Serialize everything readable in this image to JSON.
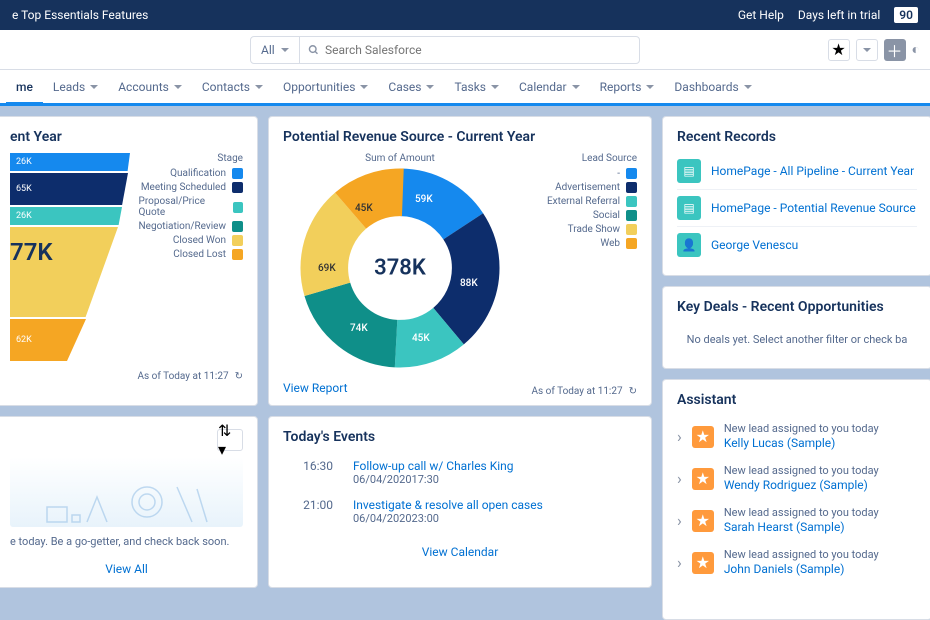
{
  "topbar": {
    "left": "e Top Essentials Features",
    "help": "Get Help",
    "daysleft_label": "Days left in trial",
    "days": "90"
  },
  "search": {
    "all": "All",
    "placeholder": "Search Salesforce"
  },
  "nav": [
    "me",
    "Leads",
    "Accounts",
    "Contacts",
    "Opportunities",
    "Cases",
    "Tasks",
    "Calendar",
    "Reports",
    "Dashboards"
  ],
  "funnel_card": {
    "title": "ent Year",
    "legend_title": "Stage",
    "legend": [
      {
        "label": "Qualification",
        "color": "#1589ee"
      },
      {
        "label": "Meeting Scheduled",
        "color": "#0d2d6c"
      },
      {
        "label": "Proposal/Price Quote",
        "color": "#3bc5c0"
      },
      {
        "label": "Negotiation/Review",
        "color": "#0f8f89"
      },
      {
        "label": "Closed Won",
        "color": "#f2cf5b"
      },
      {
        "label": "Closed Lost",
        "color": "#f5a623"
      }
    ],
    "segments": [
      "26K",
      "65K",
      "26K",
      "62K"
    ],
    "total": "77K",
    "asof": "As of Today at 11:27"
  },
  "donut_card": {
    "title": "Potential Revenue Source - Current Year",
    "subtitle": "Sum of Amount",
    "legend_title": "Lead Source",
    "legend": [
      {
        "label": "-",
        "color": "#1589ee"
      },
      {
        "label": "Advertisement",
        "color": "#0d2d6c"
      },
      {
        "label": "External Referral",
        "color": "#3bc5c0"
      },
      {
        "label": "Social",
        "color": "#0f8f89"
      },
      {
        "label": "Trade Show",
        "color": "#f2cf5b"
      },
      {
        "label": "Web",
        "color": "#f5a623"
      }
    ],
    "total": "378K",
    "labels": [
      "59K",
      "88K",
      "45K",
      "74K",
      "69K",
      "45K"
    ],
    "view_report": "View Report",
    "asof": "As of Today at 11:27"
  },
  "events_card": {
    "title": "Today's Events",
    "items": [
      {
        "time": "16:30",
        "title": "Follow-up call w/ Charles King",
        "dt": "06/04/202017:30"
      },
      {
        "time": "21:00",
        "title": "Investigate & resolve all open cases",
        "dt": "06/04/202023:00"
      }
    ],
    "link": "View Calendar"
  },
  "gogetter": {
    "text": "e today. Be a go-getter, and check back soon.",
    "link": "View All"
  },
  "records": {
    "title": "Recent Records",
    "items": [
      {
        "icon": "#3bc5c0",
        "label": "HomePage - All Pipeline - Current Year"
      },
      {
        "icon": "#3bc5c0",
        "label": "HomePage - Potential Revenue Source"
      },
      {
        "icon": "#3bc5c0",
        "label": "George Venescu",
        "user": true
      }
    ]
  },
  "deals": {
    "title": "Key Deals - Recent Opportunities",
    "empty": "No deals yet. Select another filter or check ba"
  },
  "assistant": {
    "title": "Assistant",
    "msg": "New lead assigned to you today",
    "items": [
      "Kelly Lucas (Sample)",
      "Wendy Rodriguez (Sample)",
      "Sarah Hearst (Sample)",
      "John Daniels (Sample)"
    ]
  },
  "chart_data": [
    {
      "type": "funnel",
      "title": "Pipeline - Current Year",
      "stages": [
        "Qualification",
        "Meeting Scheduled",
        "Proposal/Price Quote",
        "Negotiation/Review",
        "Closed Won",
        "Closed Lost"
      ],
      "visible_values_k": [
        26,
        65,
        26,
        62
      ],
      "highlighted_k": 77
    },
    {
      "type": "pie",
      "title": "Potential Revenue Source - Current Year",
      "categories": [
        "-",
        "Advertisement",
        "External Referral",
        "Social",
        "Trade Show",
        "Web"
      ],
      "values": [
        59,
        88,
        45,
        74,
        69,
        45
      ],
      "total": 378,
      "unit": "K"
    }
  ]
}
